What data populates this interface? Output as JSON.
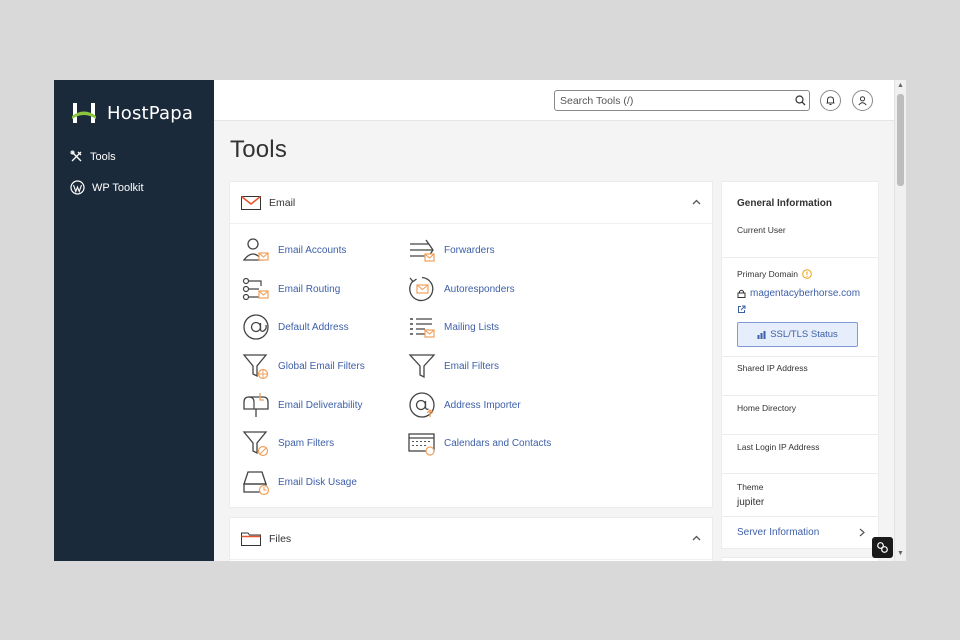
{
  "brand": {
    "name": "HostPapa",
    "accent": "#8bc53f"
  },
  "sidebar": {
    "items": [
      {
        "label": "Tools",
        "icon": "tools-icon"
      },
      {
        "label": "WP Toolkit",
        "icon": "wordpress-icon"
      }
    ]
  },
  "header": {
    "search_placeholder": "Search Tools (/)"
  },
  "page": {
    "title": "Tools"
  },
  "email_section": {
    "title": "Email",
    "tools": [
      {
        "label": "Email Accounts",
        "icon": "email-accounts-icon"
      },
      {
        "label": "Forwarders",
        "icon": "forwarders-icon"
      },
      {
        "label": "Email Routing",
        "icon": "email-routing-icon"
      },
      {
        "label": "Autoresponders",
        "icon": "autoresponders-icon"
      },
      {
        "label": "Default Address",
        "icon": "default-address-icon"
      },
      {
        "label": "Mailing Lists",
        "icon": "mailing-lists-icon"
      },
      {
        "label": "Global Email Filters",
        "icon": "global-email-filters-icon"
      },
      {
        "label": "Email Filters",
        "icon": "email-filters-icon"
      },
      {
        "label": "Email Deliverability",
        "icon": "email-deliverability-icon"
      },
      {
        "label": "Address Importer",
        "icon": "address-importer-icon"
      },
      {
        "label": "Spam Filters",
        "icon": "spam-filters-icon"
      },
      {
        "label": "Calendars and Contacts",
        "icon": "calendars-contacts-icon"
      },
      {
        "label": "Email Disk Usage",
        "icon": "email-disk-usage-icon"
      }
    ]
  },
  "files_section": {
    "title": "Files"
  },
  "general_info": {
    "title": "General Information",
    "current_user_label": "Current User",
    "primary_domain_label": "Primary Domain",
    "primary_domain": "magentacyberhorse.com",
    "ssl_button": "SSL/TLS Status",
    "shared_ip_label": "Shared IP Address",
    "home_dir_label": "Home Directory",
    "last_login_label": "Last Login IP Address",
    "theme_label": "Theme",
    "theme_value": "jupiter",
    "server_info_link": "Server Information"
  },
  "colors": {
    "sidebar_bg": "#1b2a3a",
    "link": "#3d5fa8",
    "icon_accent": "#f0a05a",
    "warning": "#e8a317"
  }
}
